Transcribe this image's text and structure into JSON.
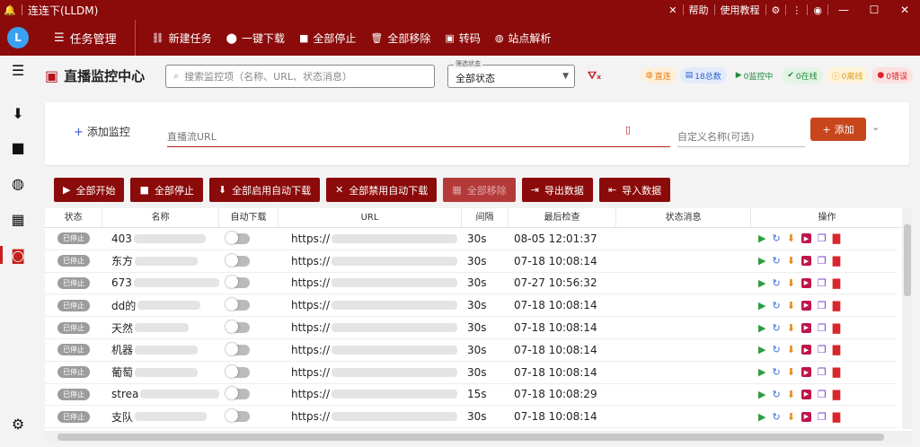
{
  "titlebar": {
    "title": "连连下(LLDM)",
    "help": "帮助",
    "tutorial": "使用教程"
  },
  "topnav": {
    "section": "任务管理",
    "items": [
      {
        "label": "新建任务",
        "icon": "link-icon"
      },
      {
        "label": "一键下载",
        "icon": "download-circle-icon"
      },
      {
        "label": "全部停止",
        "icon": "stop-icon"
      },
      {
        "label": "全部移除",
        "icon": "trash-icon"
      },
      {
        "label": "转码",
        "icon": "transcode-icon"
      },
      {
        "label": "站点解析",
        "icon": "globe-icon"
      }
    ]
  },
  "header": {
    "title": "直播监控中心",
    "search_placeholder": "搜索监控项（名称、URL、状态消息）",
    "filter_label": "筛选状态",
    "filter_value": "全部状态",
    "badges": [
      {
        "label": "直连",
        "color": "#e87a16",
        "bg": "#fdefd8",
        "icon": "globe"
      },
      {
        "label": "18总数",
        "color": "#2a5fd0",
        "bg": "#e3ebfb",
        "icon": "list"
      },
      {
        "label": "0监控中",
        "color": "#1e8a3a",
        "bg": "#f3f3f3",
        "icon": "play"
      },
      {
        "label": "0在线",
        "color": "#1e8a3a",
        "bg": "#e3f4e6",
        "icon": "check"
      },
      {
        "label": "0离线",
        "color": "#e0a020",
        "bg": "#fdf3d8",
        "icon": "info"
      },
      {
        "label": "0错误",
        "color": "#d9262c",
        "bg": "#fce1e1",
        "icon": "error"
      }
    ]
  },
  "addpanel": {
    "label": "添加监控",
    "url_placeholder": "直播流URL",
    "name_placeholder": "自定义名称(可选)",
    "add_button": "添加"
  },
  "actions": [
    {
      "label": "全部开始",
      "icon": "▶",
      "disabled": false
    },
    {
      "label": "全部停止",
      "icon": "■",
      "disabled": false
    },
    {
      "label": "全部启用自动下载",
      "icon": "⬇",
      "disabled": false
    },
    {
      "label": "全部禁用自动下载",
      "icon": "✕",
      "disabled": false
    },
    {
      "label": "全部移除",
      "icon": "🗑",
      "disabled": true
    },
    {
      "label": "导出数据",
      "icon": "⇥",
      "disabled": false
    },
    {
      "label": "导入数据",
      "icon": "⇤",
      "disabled": false
    }
  ],
  "table": {
    "columns": [
      "状态",
      "名称",
      "自动下载",
      "URL",
      "间隔",
      "最后检查",
      "状态消息",
      "操作"
    ],
    "rows": [
      {
        "status": "已停止",
        "name": "403",
        "url": "https://",
        "interval": "30s",
        "last": "08-05 12:01:37"
      },
      {
        "status": "已停止",
        "name": "东方",
        "url": "https://",
        "interval": "30s",
        "last": "07-18 10:08:14"
      },
      {
        "status": "已停止",
        "name": "673",
        "url": "https://",
        "interval": "30s",
        "last": "07-27 10:56:32"
      },
      {
        "status": "已停止",
        "name": "dd的",
        "url": "https://",
        "interval": "30s",
        "last": "07-18 10:08:14"
      },
      {
        "status": "已停止",
        "name": "天然",
        "url": "https://",
        "interval": "30s",
        "last": "07-18 10:08:14"
      },
      {
        "status": "已停止",
        "name": "机器",
        "url": "https://",
        "interval": "30s",
        "last": "07-18 10:08:14"
      },
      {
        "status": "已停止",
        "name": "葡萄",
        "url": "https://",
        "interval": "30s",
        "last": "07-18 10:08:14"
      },
      {
        "status": "已停止",
        "name": "strea",
        "url": "https://",
        "interval": "15s",
        "last": "07-18 10:08:29"
      },
      {
        "status": "已停止",
        "name": "支队",
        "url": "https://",
        "interval": "30s",
        "last": "07-18 10:08:14"
      }
    ]
  }
}
